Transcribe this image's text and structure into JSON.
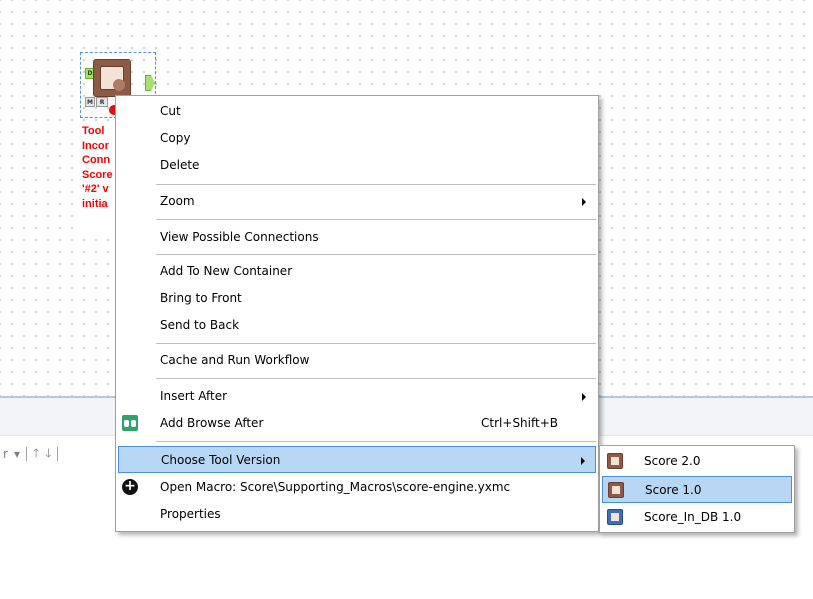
{
  "tool": {
    "anchor_d": "D",
    "anchor_m": "M",
    "anchor_r": "R",
    "annotation_lines": [
      "Tool",
      "Incor",
      "Conn",
      "Score",
      "'#2' v",
      "initia"
    ]
  },
  "results_toolbar": {
    "left_text": "r",
    "dropdown_glyph": "▾",
    "up_glyph": "🡑",
    "down_glyph": "🡓"
  },
  "context_menu": {
    "items": [
      {
        "label": "Cut"
      },
      {
        "label": "Copy"
      },
      {
        "label": "Delete"
      },
      {
        "label": "Zoom",
        "submenu": true
      },
      {
        "label": "View Possible Connections"
      },
      {
        "label": "Add To New Container"
      },
      {
        "label": "Bring to Front"
      },
      {
        "label": "Send to Back"
      },
      {
        "label": "Cache and Run Workflow"
      },
      {
        "label": "Insert After",
        "submenu": true
      },
      {
        "label": "Add Browse After",
        "shortcut": "Ctrl+Shift+B",
        "icon": "binoculars-icon"
      },
      {
        "label": "Choose Tool Version",
        "submenu": true,
        "highlighted": true
      },
      {
        "label": "Open Macro: Score\\Supporting_Macros\\score-engine.yxmc",
        "icon": "plus-circle-icon"
      },
      {
        "label": "Properties"
      }
    ]
  },
  "version_submenu": {
    "items": [
      {
        "label": "Score 2.0",
        "icon": "score-tool-icon"
      },
      {
        "label": "Score 1.0",
        "icon": "score-tool-icon",
        "highlighted": true
      },
      {
        "label": "Score_In_DB 1.0",
        "icon": "score-in-db-icon"
      }
    ]
  },
  "colors": {
    "highlight": "#b7d7f5",
    "highlight_border": "#4a90d9",
    "error_text": "#ff0000",
    "anchor_green": "#a8e06e"
  }
}
